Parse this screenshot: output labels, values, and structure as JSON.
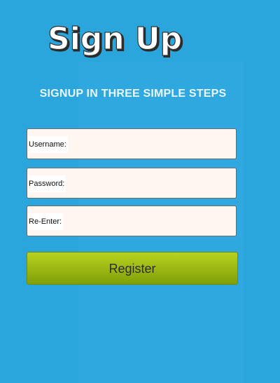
{
  "title": "Sign Up",
  "subtitle": "SIGNUP IN THREE SIMPLE STEPS",
  "fields": [
    {
      "label": "Username:",
      "value": ""
    },
    {
      "label": "Password:",
      "value": ""
    },
    {
      "label": "Re-Enter:",
      "value": ""
    }
  ],
  "button_label": "Register",
  "colors": {
    "background": "#2aa6dc",
    "button": "#a2bf17"
  }
}
